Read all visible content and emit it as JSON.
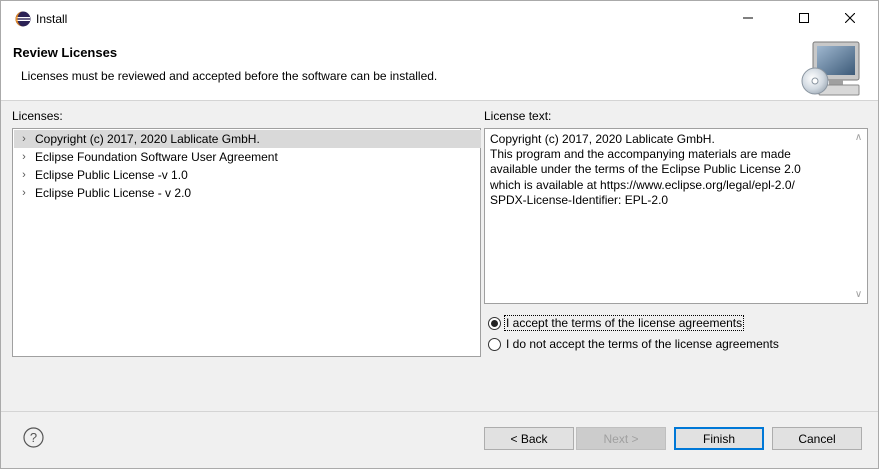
{
  "window": {
    "title": "Install",
    "icon": "eclipse-icon"
  },
  "banner": {
    "title": "Review Licenses",
    "description": "Licenses must be reviewed and accepted before the software can be installed.",
    "image": "install-cd-computer-icon"
  },
  "licenses": {
    "label": "Licenses:",
    "items": [
      {
        "label": "Copyright (c) 2017, 2020 Lablicate GmbH.",
        "selected": true
      },
      {
        "label": "Eclipse Foundation Software User Agreement",
        "selected": false
      },
      {
        "label": "Eclipse Public License -v 1.0",
        "selected": false
      },
      {
        "label": "Eclipse Public License - v 2.0",
        "selected": false
      }
    ]
  },
  "license_text": {
    "label": "License text:",
    "content": "Copyright (c) 2017, 2020 Lablicate GmbH.\nThis program and the accompanying materials are made\navailable under the terms of the Eclipse Public License 2.0\nwhich is available at https://www.eclipse.org/legal/epl-2.0/\nSPDX-License-Identifier: EPL-2.0"
  },
  "agreement": {
    "accept_label": "I accept the terms of the license agreements",
    "decline_label": "I do not accept the terms of the license agreements",
    "selected": "accept"
  },
  "buttons": {
    "back": "< Back",
    "next": "Next >",
    "finish": "Finish",
    "cancel": "Cancel"
  }
}
